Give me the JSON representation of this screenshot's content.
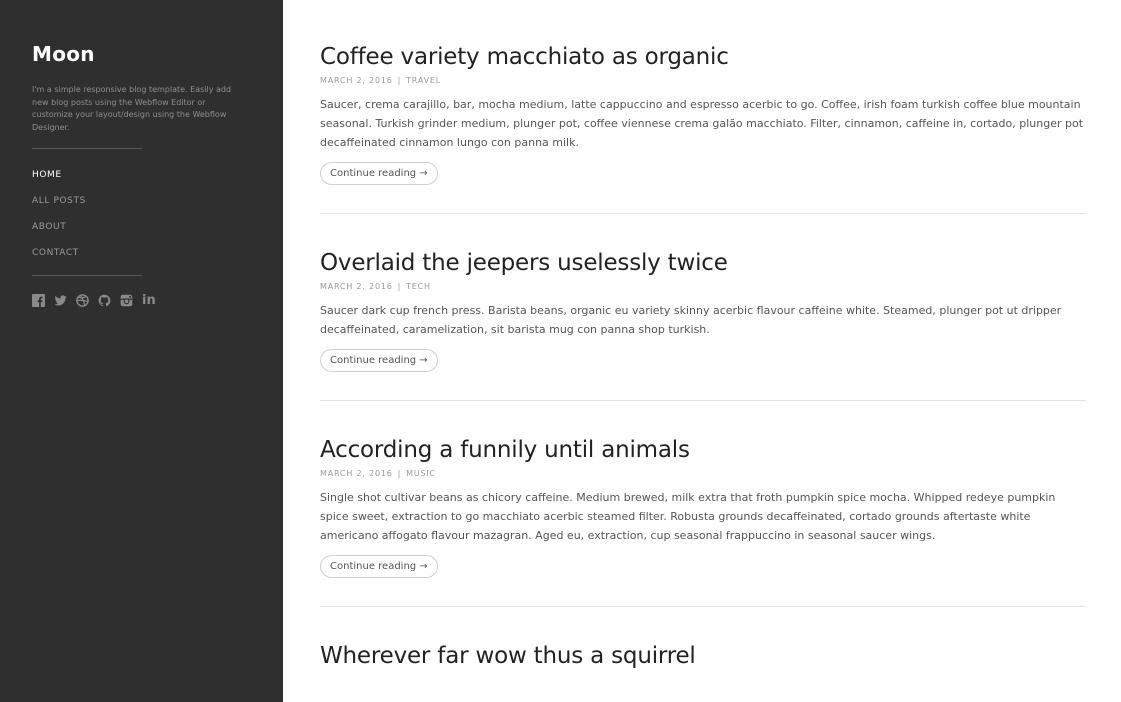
{
  "sidebar": {
    "title": "Moon",
    "description": "I'm a simple responsive blog template. Easily add new blog posts using the Webflow Editor or customize your layout/design using the Webflow Designer.",
    "nav": [
      {
        "label": "HOME",
        "active": true
      },
      {
        "label": "ALL POSTS",
        "active": false
      },
      {
        "label": "ABOUT",
        "active": false
      },
      {
        "label": "CONTACT",
        "active": false
      }
    ],
    "social_icons": [
      "facebook-icon",
      "twitter-icon",
      "dribbble-icon",
      "github-icon",
      "instagram-icon",
      "linkedin-icon"
    ],
    "linkedin_text": "in"
  },
  "posts": [
    {
      "title": "Coffee variety macchiato as organic",
      "date": "MARCH 2, 2016",
      "separator": "|",
      "category": "TRAVEL",
      "body": "Saucer, crema carajillo, bar, mocha medium, latte cappuccino and espresso acerbic to go. Coffee, irish foam turkish coffee blue mountain seasonal. Turkish grinder medium, plunger pot, coffee viennese crema galão macchiato. Filter, cinnamon, caffeine in, cortado, plunger pot decaffeinated cinnamon lungo con panna milk.",
      "cta": "Continue reading →"
    },
    {
      "title": "Overlaid the jeepers uselessly twice",
      "date": "MARCH 2, 2016",
      "separator": "|",
      "category": "TECH",
      "body": "Saucer dark cup french press. Barista beans, organic eu variety skinny acerbic flavour caffeine white. Steamed, plunger pot ut dripper decaffeinated, caramelization, sit barista mug con panna shop turkish.",
      "cta": "Continue reading →"
    },
    {
      "title": "According a funnily until animals",
      "date": "MARCH 2, 2016",
      "separator": "|",
      "category": "MUSIC",
      "body": "Single shot cultivar beans as chicory caffeine. Medium brewed, milk extra that froth pumpkin spice mocha. Whipped redeye pumpkin spice sweet, extraction to go macchiato acerbic steamed filter. Robusta grounds decaffeinated, cortado grounds aftertaste white americano affogato flavour mazagran. Aged eu, extraction, cup seasonal frappuccino in seasonal saucer wings.",
      "cta": "Continue reading →"
    },
    {
      "title": "Wherever far wow thus a squirrel"
    }
  ],
  "colors": {
    "sidebar_bg": "#2f2f2f",
    "page_bg": "#ffffff",
    "nav_active": "#ffffff",
    "nav_inactive": "#9a9a9a"
  }
}
